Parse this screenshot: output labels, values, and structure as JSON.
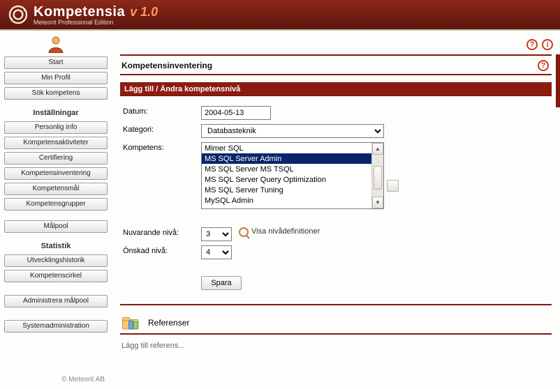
{
  "brand": {
    "name": "Kompetensia",
    "version": "v 1.0",
    "tagline": "Meteorit Professional Edition"
  },
  "sidebar": {
    "top": [
      {
        "label": "Start"
      },
      {
        "label": "Min Profil"
      },
      {
        "label": "Sök kompetens"
      }
    ],
    "headings": {
      "settings": "Inställningar",
      "stats": "Statistik"
    },
    "settings": [
      {
        "label": "Personlig info"
      },
      {
        "label": "Kompetensaktiviteter"
      },
      {
        "label": "Certifiering"
      },
      {
        "label": "Kompetensinventering"
      },
      {
        "label": "Kompetensmål"
      },
      {
        "label": "Kompetensgrupper"
      }
    ],
    "malpool": {
      "label": "Målpool"
    },
    "stats": [
      {
        "label": "Utvecklingshistorik"
      },
      {
        "label": "Kompetenscirkel"
      }
    ],
    "admin": [
      {
        "label": "Administrera målpool"
      },
      {
        "label": "Systemadministration"
      }
    ],
    "footer": "© Meteorit AB"
  },
  "main": {
    "page_title": "Kompetensinventering",
    "section_title": "Lägg till / Ändra kompetensnivå",
    "labels": {
      "datum": "Datum:",
      "kategori": "Kategori:",
      "kompetens": "Kompetens:",
      "nuvarande": "Nuvarande nivå:",
      "onskad": "Önskad nivå:"
    },
    "values": {
      "datum": "2004-05-13",
      "kategori": "Databasteknik",
      "nuvarande": "3",
      "onskad": "4"
    },
    "kompetens_options": [
      "Mimer SQL",
      "MS SQL Server Admin",
      "MS SQL Server MS TSQL",
      "MS SQL Server Query Optimization",
      "MS SQL Server Tuning",
      "MySQL Admin"
    ],
    "kompetens_selected_index": 1,
    "level_def_link": "Visa nivådefinitioner",
    "save_label": "Spara",
    "references": {
      "title": "Referenser",
      "add_label": "Lägg till referens..."
    }
  }
}
